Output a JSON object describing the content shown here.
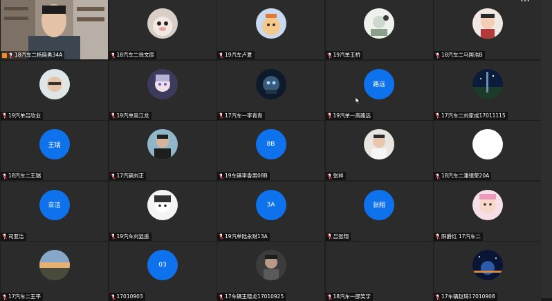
{
  "participants": [
    {
      "name": "18汽车二杨晓勇34A",
      "type": "video",
      "host": true
    },
    {
      "name": "18汽车二徐文辰",
      "type": "photo",
      "photo": "cat"
    },
    {
      "name": "19汽车卢夏",
      "type": "photo",
      "photo": "cartoon"
    },
    {
      "name": "19汽单王桥",
      "type": "photo",
      "photo": "sketch"
    },
    {
      "name": "18汽车二马国浩B",
      "type": "photo",
      "photo": "kid"
    },
    {
      "name": "19汽单吕欣业",
      "type": "photo",
      "photo": "glasses"
    },
    {
      "name": "19汽单吴江龙",
      "type": "photo",
      "photo": "anime"
    },
    {
      "name": "17汽车一李青青",
      "type": "photo",
      "photo": "robot"
    },
    {
      "name": "19汽单一高路远",
      "type": "text",
      "avatar_text": "路远"
    },
    {
      "name": "17汽车二刘家成17011115",
      "type": "photo",
      "photo": "galaxy"
    },
    {
      "name": "18汽车二王瑞",
      "type": "text",
      "avatar_text": "王瑞"
    },
    {
      "name": "17汽辆刘正",
      "type": "photo",
      "photo": "man"
    },
    {
      "name": "19车辆李香男08B",
      "type": "text",
      "avatar_text": "8B"
    },
    {
      "name": "张祥",
      "type": "photo",
      "photo": "boy"
    },
    {
      "name": "18汽车二潘镜荣20A",
      "type": "white"
    },
    {
      "name": "司亚洁",
      "type": "text",
      "avatar_text": "亚洁"
    },
    {
      "name": "19汽车刘逍遥",
      "type": "photo",
      "photo": "manga"
    },
    {
      "name": "19汽单陆永财13A",
      "type": "text",
      "avatar_text": "3A"
    },
    {
      "name": "吕张翔",
      "type": "text",
      "avatar_text": "张翔"
    },
    {
      "name": "阳爵红 17汽车二",
      "type": "photo",
      "photo": "baby"
    },
    {
      "name": "17汽车二王平",
      "type": "photo",
      "photo": "sunset"
    },
    {
      "name": "17010903",
      "type": "text",
      "avatar_text": "03"
    },
    {
      "name": "17车辆王晓龙17010925",
      "type": "photo",
      "photo": "portrait"
    },
    {
      "name": "18汽车一邵笑宇",
      "type": "none"
    },
    {
      "name": "17车辆赵琦17010908",
      "type": "photo",
      "photo": "space"
    }
  ],
  "colors": {
    "avatar_blue": "#0e72ed",
    "tile_bg": "#2b2b2b",
    "active_border": "#2a8f3e"
  },
  "icons": {
    "mic": "mic-muted-icon",
    "host": "host-icon"
  }
}
